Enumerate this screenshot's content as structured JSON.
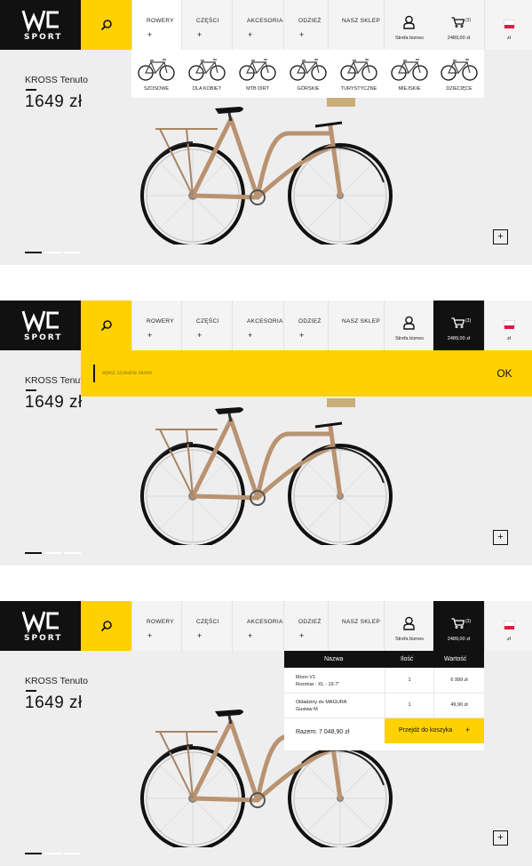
{
  "brand": {
    "logo_text": "SPORT"
  },
  "nav": {
    "items": [
      {
        "label": "ROWERY",
        "plus": "+"
      },
      {
        "label": "CZĘŚCI",
        "plus": "+"
      },
      {
        "label": "AKCESORIA",
        "plus": "+"
      },
      {
        "label": "ODZIEŻ",
        "plus": "+"
      },
      {
        "label": "NASZ SKLEP",
        "plus": ""
      }
    ],
    "account_label": "Strefa biznes",
    "cart_count": "(3)",
    "cart_amount": "2489,00 zł",
    "lang_label": "zł"
  },
  "product": {
    "name": "KROSS Tenuto",
    "price": "1649 zł",
    "zoom": "+",
    "slides": 3,
    "active_slide": 1
  },
  "bike_dropdown": {
    "items": [
      {
        "label": "SZOSOWE"
      },
      {
        "label": "DLA KOBIET"
      },
      {
        "label": "MTB DIRT"
      },
      {
        "label": "GÓRSKIE"
      },
      {
        "label": "TURYSTYCZNE"
      },
      {
        "label": "MIEJSKIE"
      },
      {
        "label": "DZIECIĘCE"
      }
    ]
  },
  "search": {
    "placeholder": "wpisz szukane słowo",
    "submit": "OK"
  },
  "cart_dropdown": {
    "headers": {
      "name": "Nazwa",
      "qty": "Ilość",
      "value": "Wartość"
    },
    "rows": [
      {
        "name": "Moon V1",
        "detail": "Rozmiar : XL - 19.7\"",
        "qty": "1",
        "value": "6 999 zł"
      },
      {
        "name": "Okładziny do MAGURA",
        "detail": "Gustaw M",
        "qty": "1",
        "value": "49,90 zł"
      }
    ],
    "total": "Razem: 7 048,90 zł",
    "checkout": "Przejdź do koszyka",
    "checkout_plus": "+"
  },
  "colors": {
    "accent": "#ffd100",
    "dark": "#111111",
    "bg": "#eeeeee"
  }
}
